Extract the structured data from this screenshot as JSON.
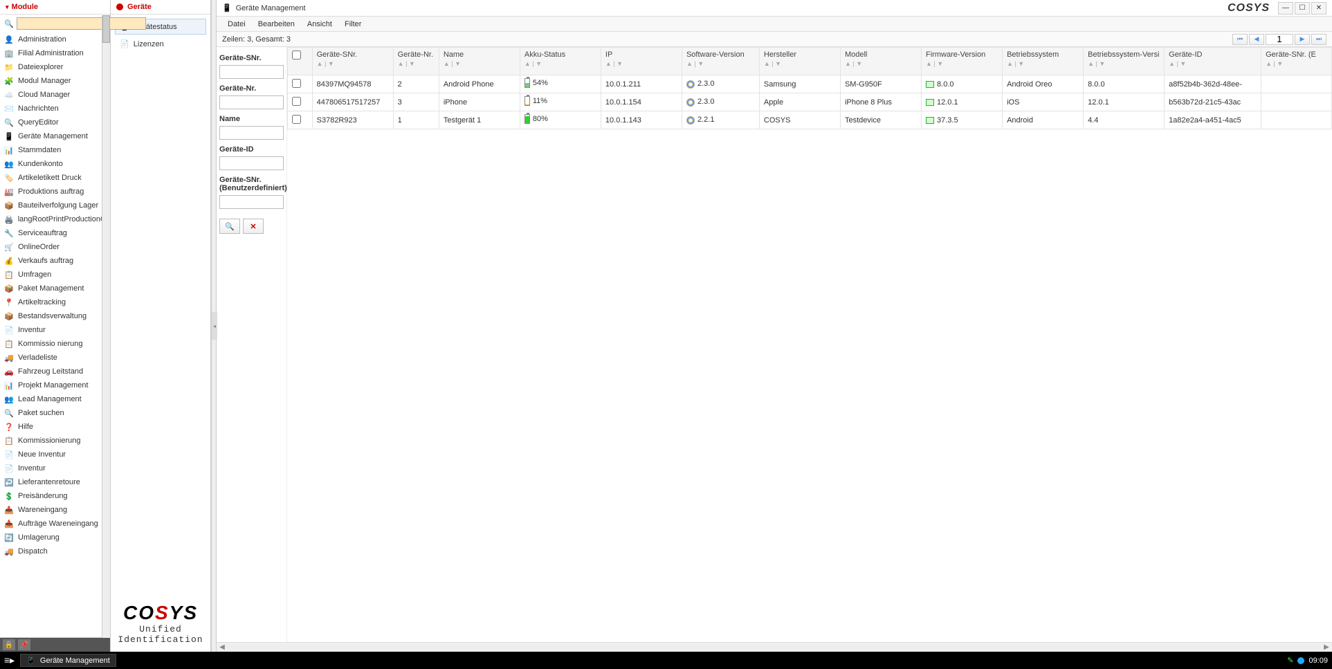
{
  "sidebar": {
    "title": "Module",
    "search_placeholder": "",
    "items": [
      {
        "icon": "👤",
        "label": "Administration"
      },
      {
        "icon": "🏢",
        "label": "Filial Administration"
      },
      {
        "icon": "📁",
        "label": "Dateiexplorer"
      },
      {
        "icon": "🧩",
        "label": "Modul Manager"
      },
      {
        "icon": "☁️",
        "label": "Cloud Manager",
        "color": "#3a90e0"
      },
      {
        "icon": "✉️",
        "label": "Nachrichten"
      },
      {
        "icon": "🔍",
        "label": "QueryEditor"
      },
      {
        "icon": "📱",
        "label": "Geräte Management"
      },
      {
        "icon": "📊",
        "label": "Stammdaten"
      },
      {
        "icon": "👥",
        "label": "Kundenkonto"
      },
      {
        "icon": "🏷️",
        "label": "Artikeletikett Druck"
      },
      {
        "icon": "🏭",
        "label": "Produktions auftrag"
      },
      {
        "icon": "📦",
        "label": "Bauteilverfolgung Lager"
      },
      {
        "icon": "🖨️",
        "label": "langRootPrintProductionO…"
      },
      {
        "icon": "🔧",
        "label": "Serviceauftrag"
      },
      {
        "icon": "🛒",
        "label": "OnlineOrder"
      },
      {
        "icon": "💰",
        "label": "Verkaufs auftrag"
      },
      {
        "icon": "📋",
        "label": "Umfragen"
      },
      {
        "icon": "📦",
        "label": "Paket Management"
      },
      {
        "icon": "📍",
        "label": "Artikeltracking"
      },
      {
        "icon": "📦",
        "label": "Bestandsverwaltung"
      },
      {
        "icon": "📄",
        "label": "Inventur"
      },
      {
        "icon": "📋",
        "label": "Kommissio nierung"
      },
      {
        "icon": "🚚",
        "label": "Verladeliste"
      },
      {
        "icon": "🚗",
        "label": "Fahrzeug Leitstand"
      },
      {
        "icon": "📊",
        "label": "Projekt Management"
      },
      {
        "icon": "👥",
        "label": "Lead Management"
      },
      {
        "icon": "🔍",
        "label": "Paket suchen"
      },
      {
        "icon": "❓",
        "label": "Hilfe",
        "color": "#3a90e0"
      },
      {
        "icon": "📋",
        "label": "Kommissionierung"
      },
      {
        "icon": "📄",
        "label": "Neue Inventur"
      },
      {
        "icon": "📄",
        "label": "Inventur"
      },
      {
        "icon": "↩️",
        "label": "Lieferantenretoure"
      },
      {
        "icon": "💲",
        "label": "Preisänderung"
      },
      {
        "icon": "📥",
        "label": "Wareneingang"
      },
      {
        "icon": "📥",
        "label": "Aufträge Wareneingang"
      },
      {
        "icon": "🔄",
        "label": "Umlagerung"
      },
      {
        "icon": "🚚",
        "label": "Dispatch"
      }
    ]
  },
  "subpanel": {
    "title": "Geräte",
    "items": [
      {
        "icon": "📱",
        "label": "Gerätestatus",
        "selected": true
      },
      {
        "icon": "📄",
        "label": "Lizenzen",
        "selected": false
      }
    ],
    "logo_tag": "Unified Identification"
  },
  "window": {
    "title": "Geräte Management",
    "brand": "COSYS"
  },
  "menu": [
    "Datei",
    "Bearbeiten",
    "Ansicht",
    "Filter"
  ],
  "status_text": "Zeilen: 3, Gesamt: 3",
  "pager": {
    "page": "1"
  },
  "filters": [
    {
      "label": "Geräte-SNr."
    },
    {
      "label": "Geräte-Nr."
    },
    {
      "label": "Name"
    },
    {
      "label": "Geräte-ID"
    },
    {
      "label": "Geräte-SNr. (Benutzerdefiniert)"
    }
  ],
  "columns": [
    "",
    "Geräte-SNr.",
    "Geräte-Nr.",
    "Name",
    "Akku-Status",
    "IP",
    "Software-Version",
    "Hersteller",
    "Modell",
    "Firmware-Version",
    "Betriebssystem",
    "Betriebssystem-Versi",
    "Geräte-ID",
    "Geräte-SNr. (E"
  ],
  "rows": [
    {
      "snr": "84397MQ94578",
      "nr": "2",
      "name": "Android Phone",
      "akku": "54%",
      "akku_pct": 54,
      "akku_color": "#7c7",
      "ip": "10.0.1.211",
      "sw": "2.3.0",
      "hersteller": "Samsung",
      "modell": "SM-G950F",
      "fw": "8.0.0",
      "os": "Android Oreo",
      "osv": "8.0.0",
      "gid": "a8f52b4b-362d-48ee-"
    },
    {
      "snr": "447806517517257",
      "nr": "3",
      "name": "iPhone",
      "akku": "11%",
      "akku_pct": 11,
      "akku_color": "#fa0",
      "ip": "10.0.1.154",
      "sw": "2.3.0",
      "hersteller": "Apple",
      "modell": "iPhone 8 Plus",
      "fw": "12.0.1",
      "os": "iOS",
      "osv": "12.0.1",
      "gid": "b563b72d-21c5-43ac"
    },
    {
      "snr": "S3782R923",
      "nr": "1",
      "name": "Testgerät 1",
      "akku": "80%",
      "akku_pct": 80,
      "akku_color": "#3c3",
      "ip": "10.0.1.143",
      "sw": "2.2.1",
      "hersteller": "COSYS",
      "modell": "Testdevice",
      "fw": "37.3.5",
      "os": "Android",
      "osv": "4.4",
      "gid": "1a82e2a4-a451-4ac5"
    }
  ],
  "taskbar": {
    "app": "Geräte Management",
    "time": "09:09"
  }
}
